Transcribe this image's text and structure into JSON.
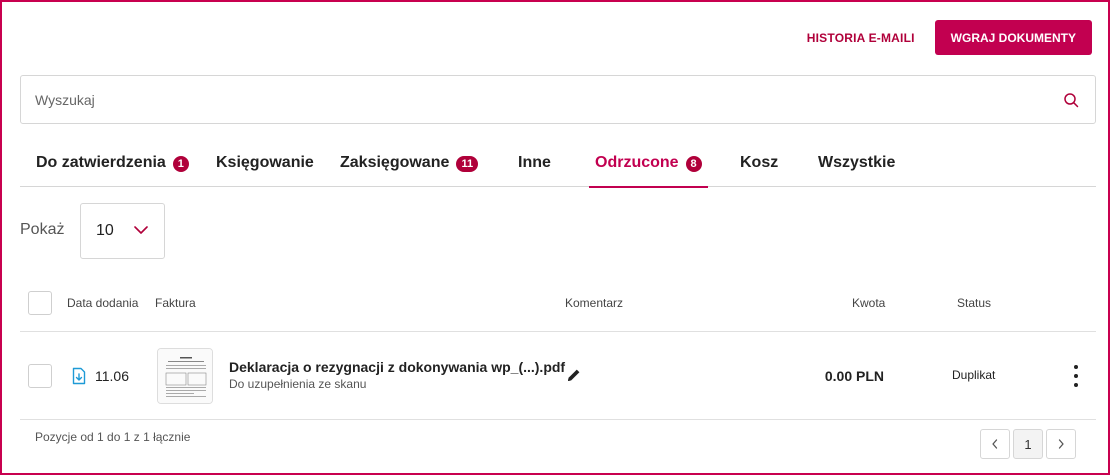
{
  "header": {
    "history_label": "HISTORIA E-MAILI",
    "upload_label": "WGRAJ DOKUMENTY"
  },
  "search": {
    "placeholder": "Wyszukaj",
    "value": ""
  },
  "tabs": [
    {
      "label": "Do zatwierdzenia",
      "badge": "1"
    },
    {
      "label": "Księgowanie"
    },
    {
      "label": "Zaksięgowane",
      "badge": "11"
    },
    {
      "label": "Inne"
    },
    {
      "label": "Odrzucone",
      "badge": "8",
      "active": true
    },
    {
      "label": "Kosz"
    },
    {
      "label": "Wszystkie"
    }
  ],
  "page_size": {
    "label": "Pokaż",
    "value": "10"
  },
  "table": {
    "columns": [
      "Data dodania",
      "Faktura",
      "Komentarz",
      "Kwota",
      "Status"
    ],
    "rows": [
      {
        "date": "11.06",
        "title": "Deklaracja o rezygnacji z dokonywania wp_(...).pdf",
        "subtitle": "Do uzupełnienia ze skanu",
        "amount": "0.00 PLN",
        "status": "Duplikat"
      }
    ]
  },
  "footer": {
    "summary": "Pozycje od 1 do 1 z 1 łącznie",
    "current_page": "1"
  },
  "colors": {
    "accent": "#c20050",
    "border": "#d6d6d6"
  },
  "icons": [
    "search-icon",
    "chevron-down-icon",
    "file-icon",
    "pencil-icon",
    "more-vertical-icon",
    "chevron-left-icon",
    "chevron-right-icon"
  ]
}
